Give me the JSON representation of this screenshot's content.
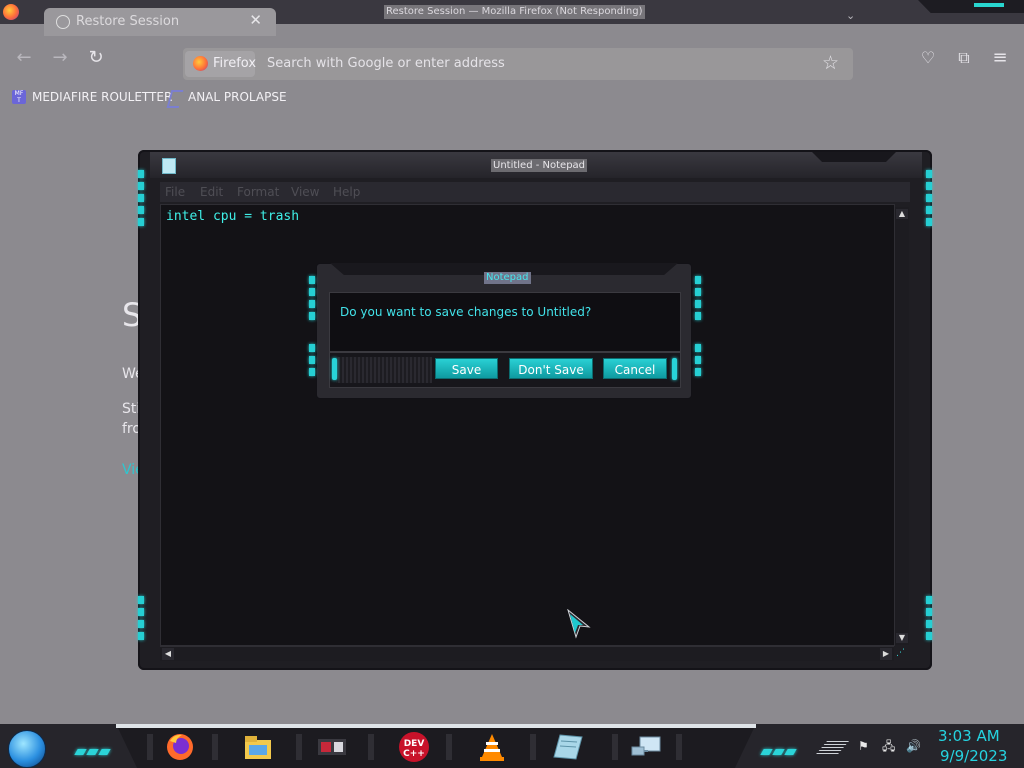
{
  "firefox": {
    "tab_title": "Restore Session",
    "window_title": "Restore Session — Mozilla Firefox (Not Responding)",
    "url_chip_label": "Firefox",
    "url_placeholder": "Search with Google or enter address",
    "bookmarks": [
      {
        "label": "MEDIAFIRE ROULETTER",
        "icon": "mediafire-icon"
      },
      {
        "label": "ANAL PROLAPSE",
        "icon": "bookmark-icon"
      }
    ],
    "content_fragments": {
      "heading": "S",
      "line1": "We",
      "line2a": "Sti",
      "line2b": "fro",
      "link": "Vie"
    }
  },
  "notepad": {
    "title": "Untitled - Notepad",
    "menu": [
      "File",
      "Edit",
      "Format",
      "View",
      "Help"
    ],
    "text": "intel cpu = trash"
  },
  "dialog": {
    "title": "Notepad",
    "message": "Do you want to save changes to Untitled?",
    "buttons": {
      "save": "Save",
      "dont_save": "Don't Save",
      "cancel": "Cancel"
    }
  },
  "taskbar": {
    "apps": [
      "firefox-icon",
      "file-explorer-icon",
      "media-app-icon",
      "dev-cpp-icon",
      "vlc-icon",
      "notepad-icon",
      "network-app-icon"
    ],
    "devcpp_label": "DEV\nC++",
    "time": "3:03 AM",
    "date": "9/9/2023"
  },
  "colors": {
    "accent": "#28d3d8",
    "clock": "#25d3e0",
    "dialog_text": "#42e3ea"
  }
}
